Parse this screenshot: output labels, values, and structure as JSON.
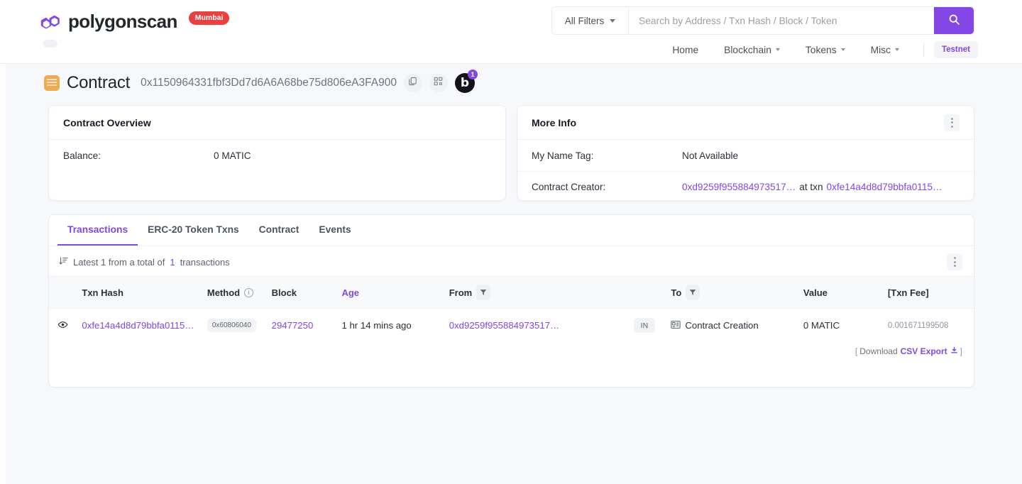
{
  "header": {
    "brand_name": "polygonscan",
    "brand_pill": "Mumbai",
    "brand_pill_color": "#e84142",
    "accent_color": "#8247e5",
    "search": {
      "filter_label": "All Filters",
      "placeholder": "Search by Address / Txn Hash / Block / Token",
      "value": "",
      "search_icon": "search-icon"
    },
    "nav": [
      {
        "label": "Home",
        "has_caret": false
      },
      {
        "label": "Blockchain",
        "has_caret": true
      },
      {
        "label": "Tokens",
        "has_caret": true
      },
      {
        "label": "Misc",
        "has_caret": true
      }
    ],
    "network_pill": "Testnet"
  },
  "title": {
    "icon": "contract-icon",
    "label": "Contract",
    "address": "0x1150964331fbf3Dd7d6A6A68be75d806eA3FA900",
    "copy_icon": "copy-icon",
    "qr_icon": "qr-code-icon",
    "blockscan_letter": "b",
    "blockscan_badge": "1"
  },
  "overview": {
    "title": "Contract Overview",
    "rows": [
      {
        "label": "Balance:",
        "value": "0 MATIC"
      }
    ]
  },
  "more_info": {
    "title": "More Info",
    "kebab_icon": "kebab-menu-icon",
    "name_tag_label": "My Name Tag:",
    "name_tag_value": "Not Available",
    "creator_label": "Contract Creator:",
    "creator_address": "0xd9259f955884973517…",
    "creator_at": "at txn",
    "creator_txn": "0xfe14a4d8d79bbfa0115…"
  },
  "txn_panel": {
    "tabs": [
      {
        "label": "Transactions",
        "active": true
      },
      {
        "label": "ERC-20 Token Txns",
        "active": false
      },
      {
        "label": "Contract",
        "active": false
      },
      {
        "label": "Events",
        "active": false
      }
    ],
    "sort_icon": "sort-descending-icon",
    "summary_prefix": "Latest 1 from a total of",
    "summary_count": "1",
    "summary_suffix": "transactions",
    "kebab_icon": "kebab-menu-icon",
    "columns": [
      {
        "label": "",
        "key": "eye"
      },
      {
        "label": "Txn Hash",
        "key": "hash"
      },
      {
        "label": "Method",
        "key": "method",
        "info": true
      },
      {
        "label": "Block",
        "key": "block"
      },
      {
        "label": "Age",
        "key": "age",
        "sorted": true
      },
      {
        "label": "From",
        "key": "from",
        "filter": true
      },
      {
        "label": "",
        "key": "dir"
      },
      {
        "label": "To",
        "key": "to",
        "filter": true
      },
      {
        "label": "Value",
        "key": "value"
      },
      {
        "label": "[Txn Fee]",
        "key": "fee"
      }
    ],
    "rows": [
      {
        "eye_icon": "eye-icon",
        "hash": "0xfe14a4d8d79bbfa0115…",
        "method": "0x60806040",
        "block": "29477250",
        "age": "1 hr 14 mins ago",
        "from": "0xd9259f955884973517…",
        "direction": "IN",
        "to_icon": "contract-creation-icon",
        "to": "Contract Creation",
        "value": "0 MATIC",
        "fee": "0.001671199508"
      }
    ],
    "csv_open_bracket": "[",
    "csv_prefix": "Download",
    "csv_label": "CSV Export",
    "csv_icon": "download-icon",
    "csv_close_bracket": "]"
  }
}
